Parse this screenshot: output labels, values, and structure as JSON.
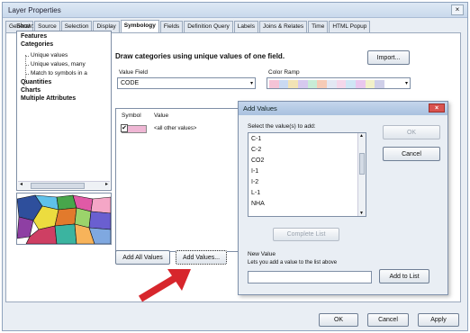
{
  "window": {
    "title": "Layer Properties",
    "close_glyph": "×"
  },
  "tabs": [
    "General",
    "Source",
    "Selection",
    "Display",
    "Symbology",
    "Fields",
    "Definition Query",
    "Labels",
    "Joins & Relates",
    "Time",
    "HTML Popup"
  ],
  "active_tab": "Symbology",
  "show": {
    "label": "Show:",
    "items": [
      {
        "label": "Features",
        "bold": true
      },
      {
        "label": "Categories",
        "bold": true
      },
      {
        "label": "Unique values",
        "bold": false
      },
      {
        "label": "Unique values, many",
        "bold": false
      },
      {
        "label": "Match to symbols in a",
        "bold": false
      },
      {
        "label": "Quantities",
        "bold": true
      },
      {
        "label": "Charts",
        "bold": true
      },
      {
        "label": "Multiple Attributes",
        "bold": true
      }
    ],
    "scroll_left": "◂",
    "scroll_right": "▸"
  },
  "main": {
    "heading": "Draw categories using unique values of one field.",
    "import_label": "Import...",
    "value_field_label": "Value Field",
    "value_field_value": "CODE",
    "color_ramp_label": "Color Ramp",
    "dropdown_glyph": "▾",
    "ramp_colors": [
      "#f4c3d6",
      "#c9d9f2",
      "#f2e3b5",
      "#d6c9ef",
      "#c8ecd6",
      "#f6cbb6",
      "#e3e8f3",
      "#f4d7ea",
      "#cfe6f5",
      "#e9c7ee",
      "#f2f1c9",
      "#cfcfe9"
    ]
  },
  "symbols": {
    "symbol_header": "Symbol",
    "value_header": "Value",
    "rows": [
      {
        "value": "<all other values>",
        "checked": true
      }
    ],
    "check_glyph": "✔"
  },
  "buttons": {
    "add_all": "Add All Values",
    "add_values": "Add Values...",
    "ok": "OK",
    "cancel": "Cancel",
    "apply": "Apply"
  },
  "dialog": {
    "title": "Add Values",
    "close_glyph": "×",
    "select_label": "Select the value(s) to add:",
    "values": [
      "C-1",
      "C-2",
      "CO2",
      "I-1",
      "I-2",
      "L-1",
      "NHA"
    ],
    "complete_list": "Complete List",
    "new_value_label": "New Value",
    "new_value_hint": "Lets you add a value to the list above",
    "new_value": "",
    "add_to_list": "Add to List",
    "ok": "OK",
    "cancel": "Cancel"
  },
  "colors": {
    "accent_arrow": "#d7262c",
    "dialog_close": "#d9534f"
  }
}
